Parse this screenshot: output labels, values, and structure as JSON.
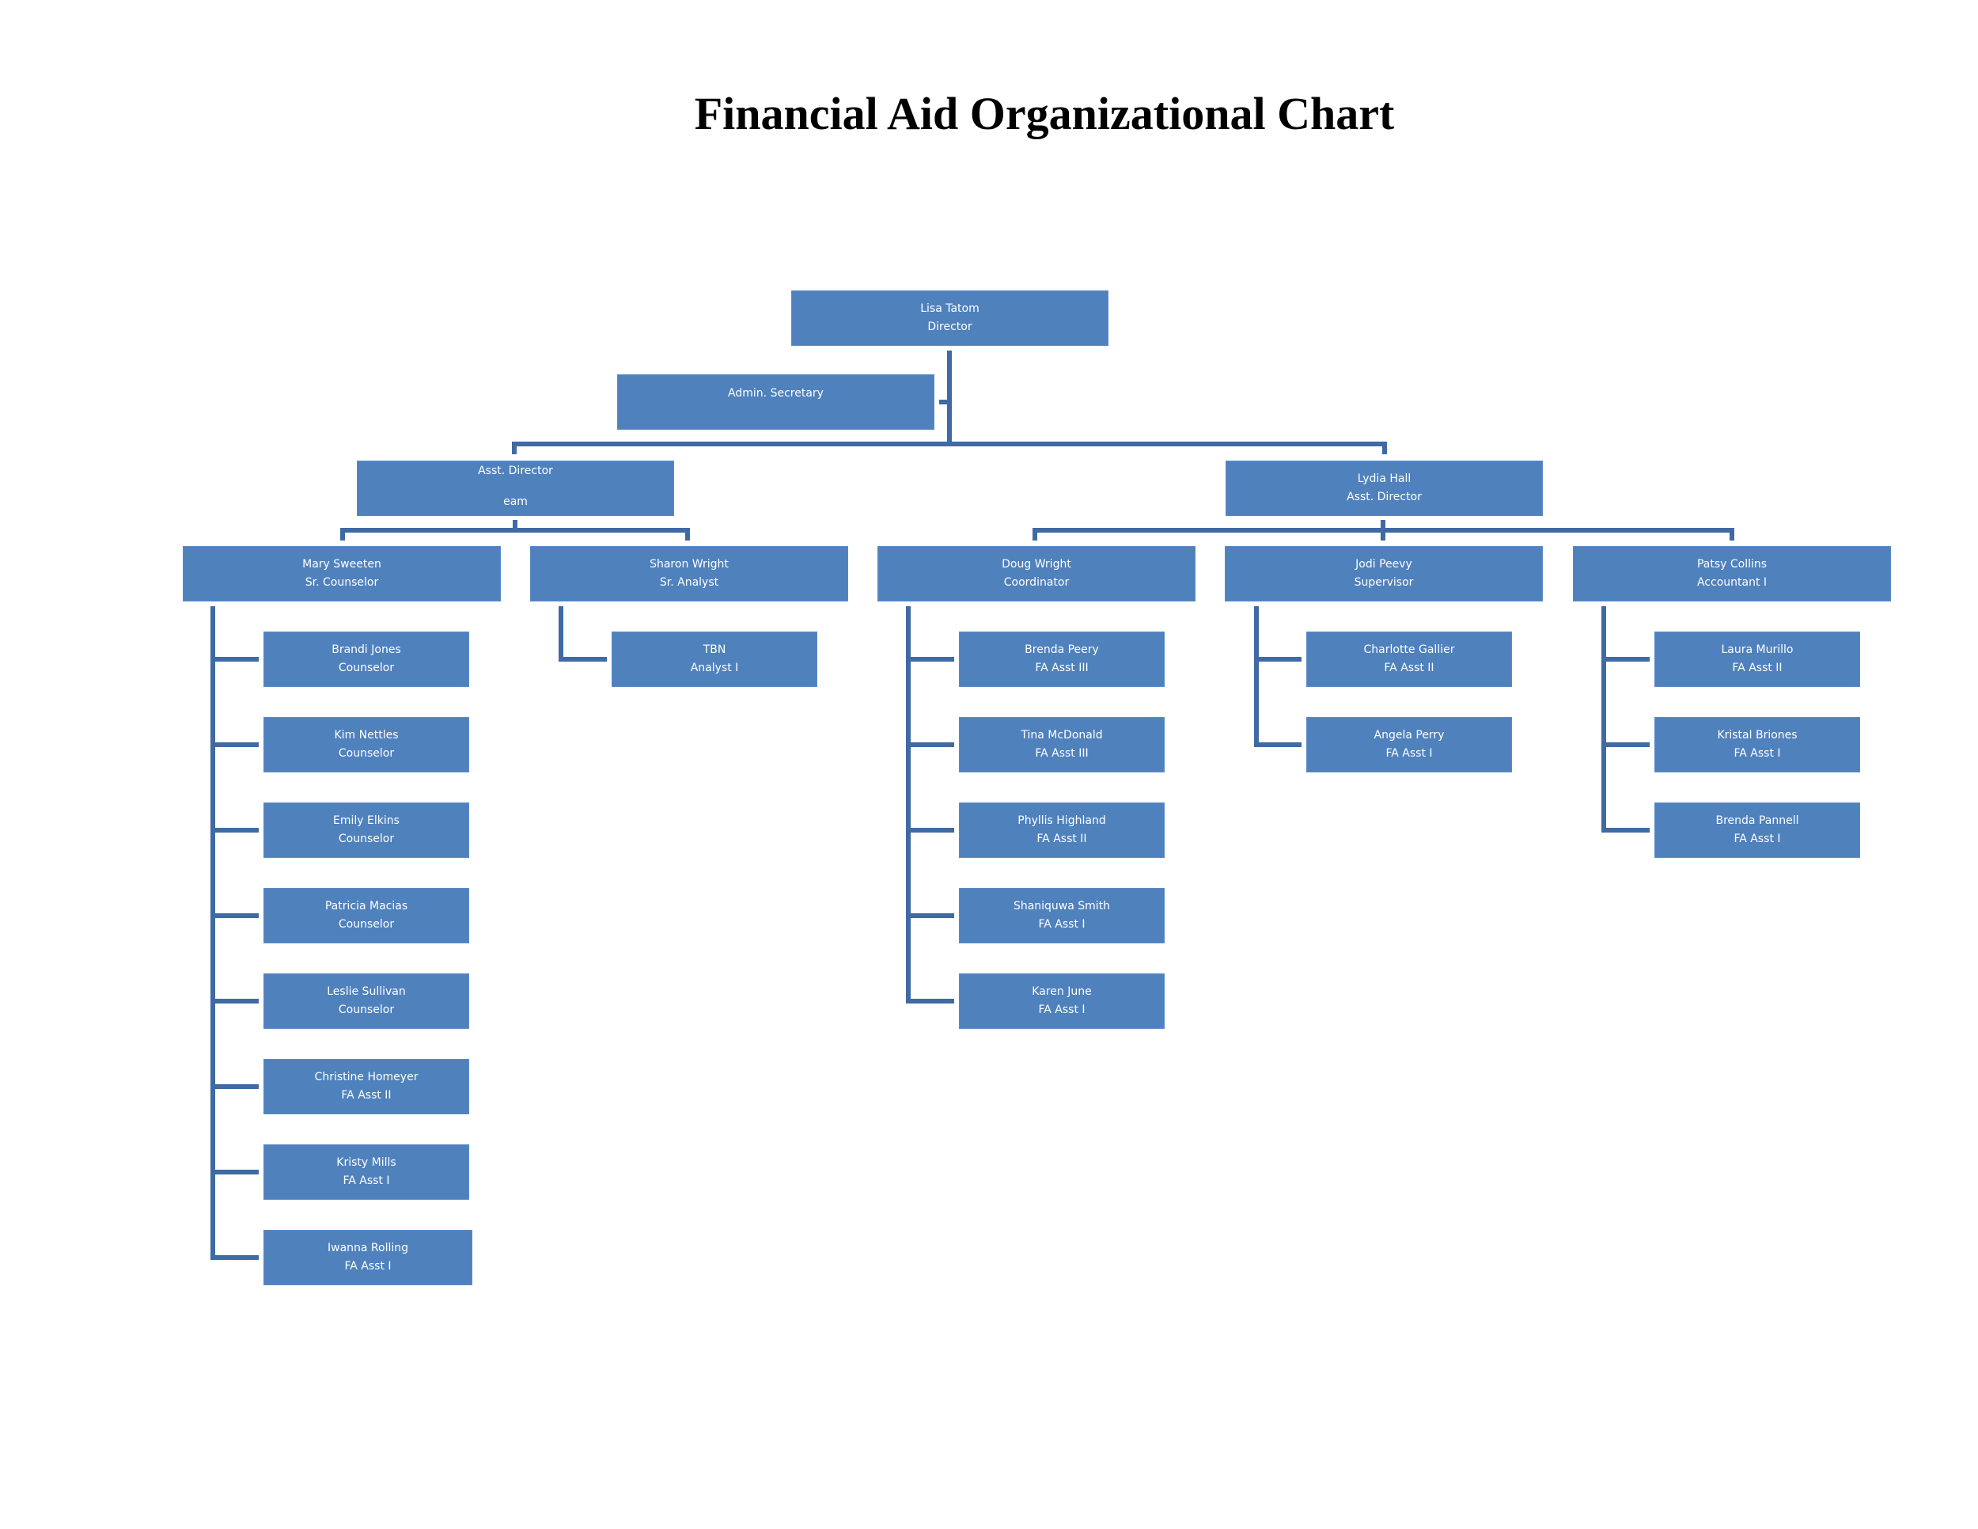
{
  "title": "Financial Aid Organizational Chart",
  "colors": {
    "box_fill": "#4f81bd",
    "connector": "#3f6aa3",
    "text": "#ffffff"
  },
  "director": {
    "name": "Lisa Tatom",
    "role": "Director"
  },
  "secretary": {
    "name": "",
    "role": "Admin. Secretary"
  },
  "asst_directors": [
    {
      "name": "Asst. Director",
      "role": "eam"
    },
    {
      "name": "Lydia Hall",
      "role": "Asst. Director"
    }
  ],
  "managers": [
    {
      "name": "Mary Sweeten",
      "role": "Sr. Counselor"
    },
    {
      "name": "Sharon Wright",
      "role": "Sr. Analyst"
    },
    {
      "name": "Doug Wright",
      "role": "Coordinator"
    },
    {
      "name": "Jodi Peevy",
      "role": "Supervisor"
    },
    {
      "name": "Patsy Collins",
      "role": "Accountant I"
    }
  ],
  "teams": [
    [
      {
        "name": "Brandi Jones",
        "role": "Counselor"
      },
      {
        "name": "Kim Nettles",
        "role": "Counselor"
      },
      {
        "name": "Emily Elkins",
        "role": "Counselor"
      },
      {
        "name": "Patricia Macias",
        "role": "Counselor"
      },
      {
        "name": "Leslie Sullivan",
        "role": "Counselor"
      },
      {
        "name": "Christine Homeyer",
        "role": "FA Asst II"
      },
      {
        "name": "Kristy Mills",
        "role": "FA Asst I"
      },
      {
        "name": "Iwanna Rolling",
        "role": "FA Asst I"
      }
    ],
    [
      {
        "name": "TBN",
        "role": "Analyst I"
      }
    ],
    [
      {
        "name": "Brenda Peery",
        "role": "FA Asst III"
      },
      {
        "name": "Tina McDonald",
        "role": "FA Asst III"
      },
      {
        "name": "Phyllis Highland",
        "role": "FA Asst II"
      },
      {
        "name": "Shaniquwa Smith",
        "role": "FA Asst I"
      },
      {
        "name": "Karen June",
        "role": "FA Asst I"
      }
    ],
    [
      {
        "name": "Charlotte Gallier",
        "role": "FA Asst II"
      },
      {
        "name": "Angela Perry",
        "role": "FA Asst I"
      }
    ],
    [
      {
        "name": "Laura Murillo",
        "role": "FA Asst II"
      },
      {
        "name": "Kristal Briones",
        "role": "FA Asst I"
      },
      {
        "name": "Brenda Pannell",
        "role": "FA Asst I"
      }
    ]
  ]
}
